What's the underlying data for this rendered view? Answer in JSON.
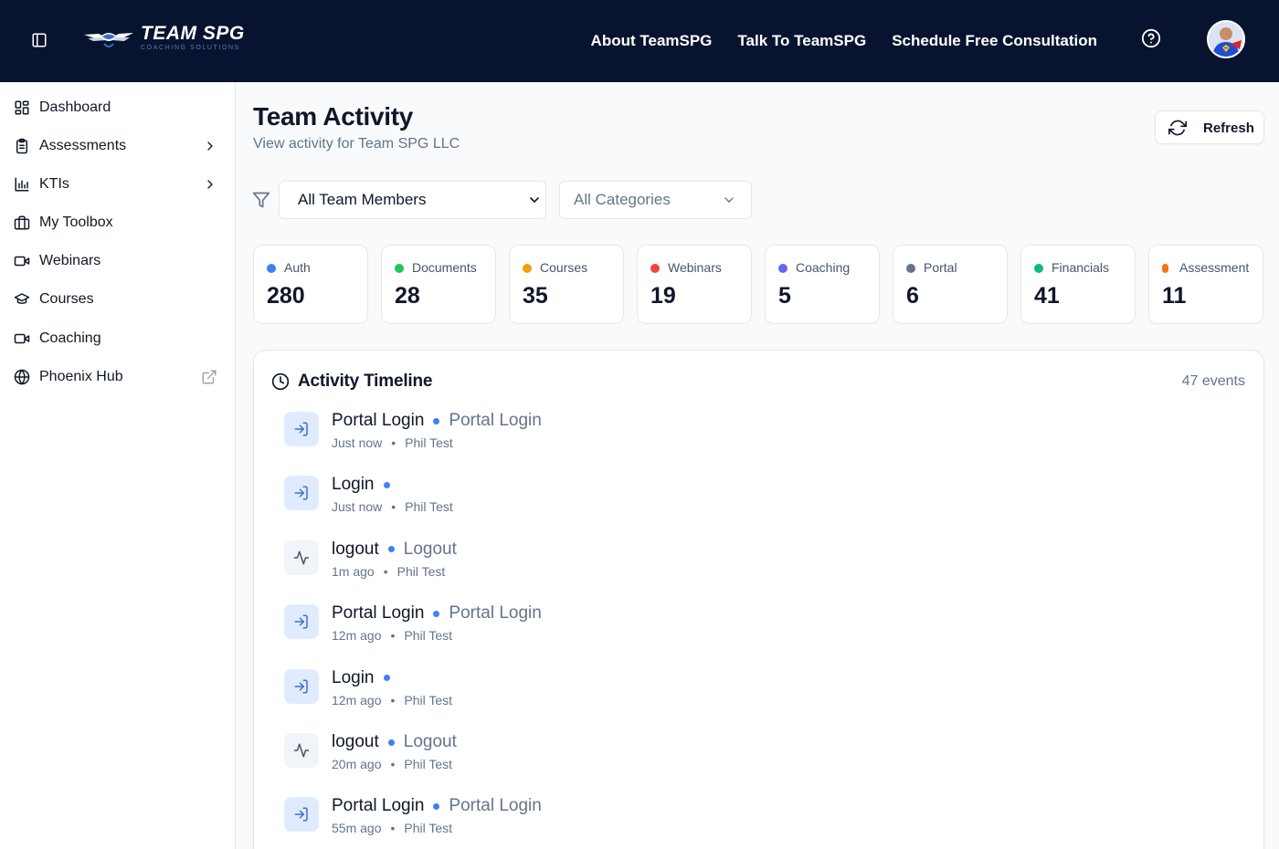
{
  "brand": {
    "name": "TEAM SPG",
    "tagline": "COACHING SOLUTIONS"
  },
  "topnav": {
    "links": [
      "About TeamSPG",
      "Talk To TeamSPG",
      "Schedule Free Consultation"
    ]
  },
  "sidebar": {
    "items": [
      {
        "label": "Dashboard",
        "icon": "dashboard-icon"
      },
      {
        "label": "Assessments",
        "icon": "clipboard-icon",
        "has_children": true
      },
      {
        "label": "KTIs",
        "icon": "bar-chart-icon",
        "has_children": true
      },
      {
        "label": "My Toolbox",
        "icon": "toolbox-icon"
      },
      {
        "label": "Webinars",
        "icon": "video-icon"
      },
      {
        "label": "Courses",
        "icon": "graduation-cap-icon"
      },
      {
        "label": "Coaching",
        "icon": "video-icon"
      },
      {
        "label": "Phoenix Hub",
        "icon": "globe-icon",
        "external": true
      }
    ]
  },
  "page": {
    "title": "Team Activity",
    "subtitle": "View activity for Team SPG LLC",
    "refresh_label": "Refresh"
  },
  "filters": {
    "members_value": "All Team Members",
    "categories_placeholder": "All Categories"
  },
  "stats": [
    {
      "label": "Auth",
      "value": "280",
      "color": "#3b82f6"
    },
    {
      "label": "Documents",
      "value": "28",
      "color": "#22c55e"
    },
    {
      "label": "Courses",
      "value": "35",
      "color": "#f59e0b"
    },
    {
      "label": "Webinars",
      "value": "19",
      "color": "#ef4444"
    },
    {
      "label": "Coaching",
      "value": "5",
      "color": "#6366f1"
    },
    {
      "label": "Portal",
      "value": "6",
      "color": "#64748b"
    },
    {
      "label": "Financials",
      "value": "41",
      "color": "#10b981"
    },
    {
      "label": "Assessment",
      "value": "11",
      "color": "#f97316"
    }
  ],
  "timeline": {
    "title": "Activity Timeline",
    "count": "47 events",
    "events": [
      {
        "title": "Portal Login",
        "subtitle": "Portal Login",
        "time": "Just now",
        "user": "Phil Test",
        "kind": "login"
      },
      {
        "title": "Login",
        "subtitle": "",
        "time": "Just now",
        "user": "Phil Test",
        "kind": "login"
      },
      {
        "title": "logout",
        "subtitle": "Logout",
        "time": "1m ago",
        "user": "Phil Test",
        "kind": "activity"
      },
      {
        "title": "Portal Login",
        "subtitle": "Portal Login",
        "time": "12m ago",
        "user": "Phil Test",
        "kind": "login"
      },
      {
        "title": "Login",
        "subtitle": "",
        "time": "12m ago",
        "user": "Phil Test",
        "kind": "login"
      },
      {
        "title": "logout",
        "subtitle": "Logout",
        "time": "20m ago",
        "user": "Phil Test",
        "kind": "activity"
      },
      {
        "title": "Portal Login",
        "subtitle": "Portal Login",
        "time": "55m ago",
        "user": "Phil Test",
        "kind": "login"
      }
    ]
  },
  "colors": {
    "nav_bg": "#08142f",
    "accent": "#3b82f6"
  }
}
